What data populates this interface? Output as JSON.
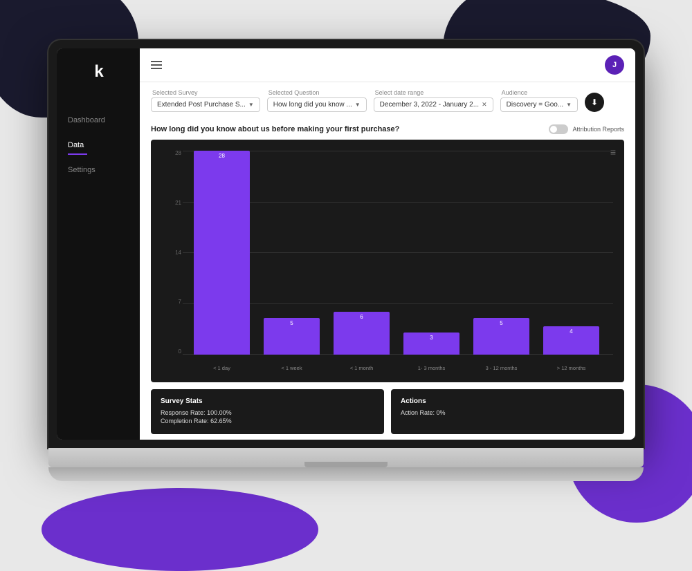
{
  "background": {
    "color": "#e8e8e8"
  },
  "sidebar": {
    "logo": "k",
    "nav_items": [
      {
        "label": "Dashboard",
        "active": false
      },
      {
        "label": "Data",
        "active": true
      },
      {
        "label": "Settings",
        "active": false
      }
    ]
  },
  "topbar": {
    "avatar_label": "J"
  },
  "filters": {
    "selected_survey_label": "Selected Survey",
    "selected_survey_value": "Extended Post Purchase S...",
    "selected_question_label": "Selected Question",
    "selected_question_value": "How long did you know ...",
    "date_range_label": "Select date range",
    "date_range_value": "December 3, 2022 - January 2...",
    "audience_label": "Audience",
    "audience_value": "Discovery = Goo..."
  },
  "question_title": "How long did you know about us before making your first purchase?",
  "attribution_label": "Attribution Reports",
  "chart": {
    "title": "Bar chart",
    "y_labels": [
      "28",
      "21",
      "14",
      "7",
      "0"
    ],
    "bars": [
      {
        "label": "< 1 day",
        "value": 28,
        "height_pct": 100,
        "display": "28"
      },
      {
        "label": "< 1 week",
        "value": 5,
        "height_pct": 18,
        "display": "5"
      },
      {
        "label": "< 1 month",
        "value": 6,
        "height_pct": 21,
        "display": "6"
      },
      {
        "label": "1- 3 months",
        "value": 3,
        "height_pct": 11,
        "display": "3"
      },
      {
        "label": "3 - 12 months",
        "value": 5,
        "height_pct": 18,
        "display": "5"
      },
      {
        "label": "> 12 months",
        "value": 4,
        "height_pct": 14,
        "display": "4"
      }
    ]
  },
  "survey_stats": {
    "title": "Survey Stats",
    "response_rate_label": "Response Rate:",
    "response_rate_value": "100.00%",
    "completion_rate_label": "Completion Rate:",
    "completion_rate_value": "62.65%"
  },
  "actions_stats": {
    "title": "Actions",
    "action_rate_label": "Action Rate:",
    "action_rate_value": "0%"
  }
}
